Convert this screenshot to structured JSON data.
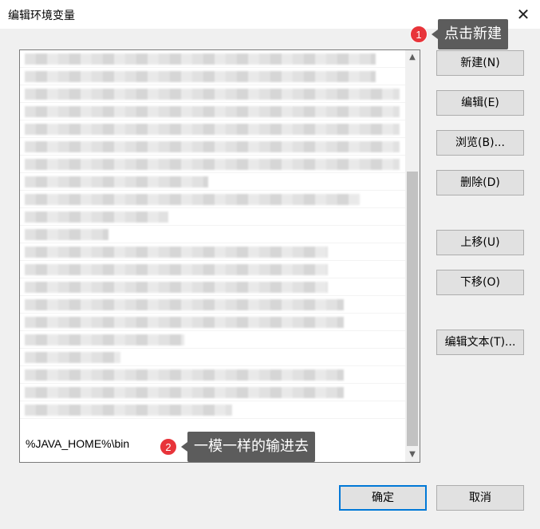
{
  "window": {
    "title": "编辑环境变量",
    "close_glyph": "✕"
  },
  "list": {
    "visible_last_entry": "%JAVA_HOME%\\bin",
    "scroll_up_glyph": "▲",
    "scroll_down_glyph": "▼"
  },
  "buttons": {
    "new": "新建(N)",
    "edit": "编辑(E)",
    "browse": "浏览(B)...",
    "delete": "删除(D)",
    "move_up": "上移(U)",
    "move_down": "下移(O)",
    "edit_text": "编辑文本(T)...",
    "ok": "确定",
    "cancel": "取消"
  },
  "annotations": [
    {
      "number": "1",
      "text": "点击新建"
    },
    {
      "number": "2",
      "text": "一模一样的输进去"
    }
  ],
  "colors": {
    "badge": "#e8343a",
    "callout": "#5c5c5c",
    "focus_border": "#0078d7"
  }
}
